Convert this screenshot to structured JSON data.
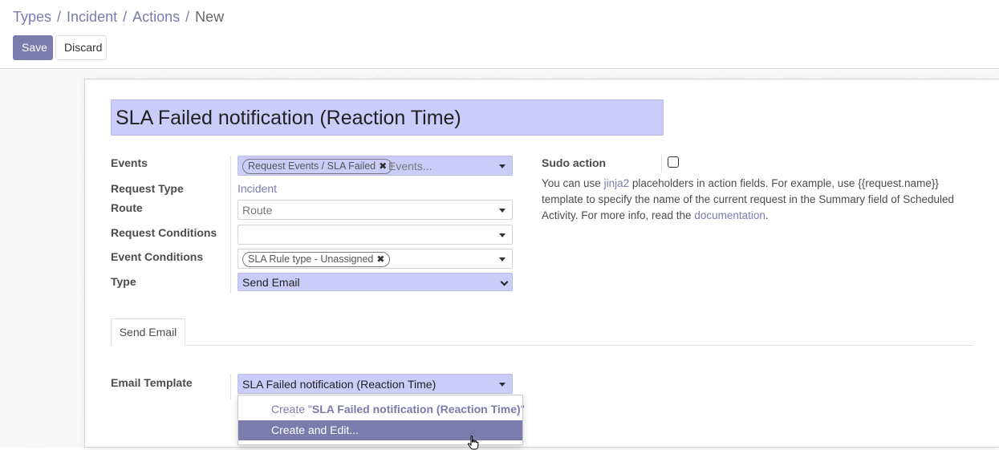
{
  "breadcrumb": {
    "items": [
      "Types",
      "Incident",
      "Actions"
    ],
    "current": "New",
    "separator": "/"
  },
  "toolbar": {
    "save_label": "Save",
    "discard_label": "Discard"
  },
  "form": {
    "name_value": "SLA Failed notification (Reaction Time)",
    "events": {
      "label": "Events",
      "tags": [
        "Request Events / SLA Failed"
      ],
      "placeholder": "Events..."
    },
    "request_type": {
      "label": "Request Type",
      "value": "Incident"
    },
    "route": {
      "label": "Route",
      "placeholder": "Route"
    },
    "request_conditions": {
      "label": "Request Conditions",
      "value": ""
    },
    "event_conditions": {
      "label": "Event Conditions",
      "tags": [
        "SLA Rule type - Unassigned"
      ]
    },
    "type": {
      "label": "Type",
      "value": "Send Email"
    },
    "sudo_action": {
      "label": "Sudo action",
      "checked": false
    },
    "help": {
      "part1": "You can use ",
      "link1": "jinja2",
      "part2": " placeholders in action fields. For example, use {{request.name}} template to specify the name of the current request in the Summary field of Scheduled Activity. For more info, read the ",
      "link2": "documentation",
      "part3": "."
    }
  },
  "tabs": [
    {
      "label": "Send Email",
      "active": true
    }
  ],
  "email_template": {
    "label": "Email Template",
    "value": "SLA Failed notification (Reaction Time)",
    "dropdown": {
      "create_prefix": "Create \"",
      "create_name": "SLA Failed notification (Reaction Time)",
      "create_suffix": "\"",
      "create_edit_label": "Create and Edit..."
    }
  },
  "colors": {
    "accent": "#7c7bad",
    "required_field": "#ccccfb"
  },
  "icons": {
    "remove_tag": "close-icon",
    "dropdown": "caret-down-icon",
    "cursor": "hand-pointer-icon"
  }
}
